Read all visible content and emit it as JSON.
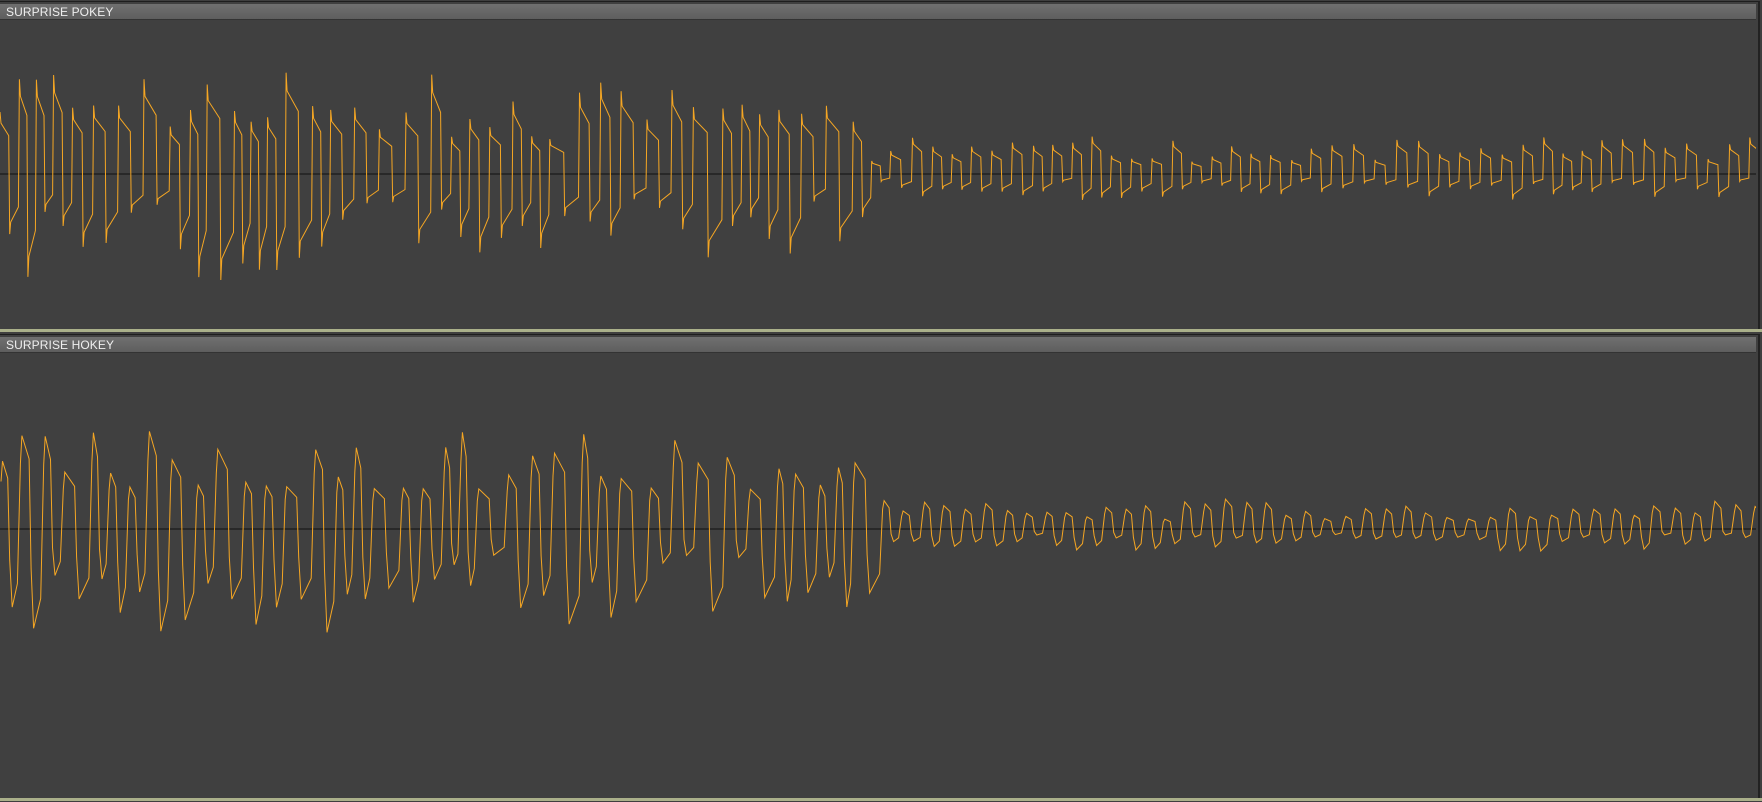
{
  "colors": {
    "background": "#404040",
    "header": "#666666",
    "waveform": "#f5a623",
    "center_line": "#111111",
    "separator": "#aab08a"
  },
  "tracks": [
    {
      "name": "SURPRISE POKEY",
      "waveform_style": "pulse",
      "seed": 11,
      "amplitude_profile": [
        0.78,
        0.55,
        0.22
      ]
    },
    {
      "name": "SURPRISE HOKEY",
      "waveform_style": "smooth",
      "seed": 23,
      "amplitude_profile": [
        0.55,
        0.42,
        0.12
      ]
    }
  ]
}
